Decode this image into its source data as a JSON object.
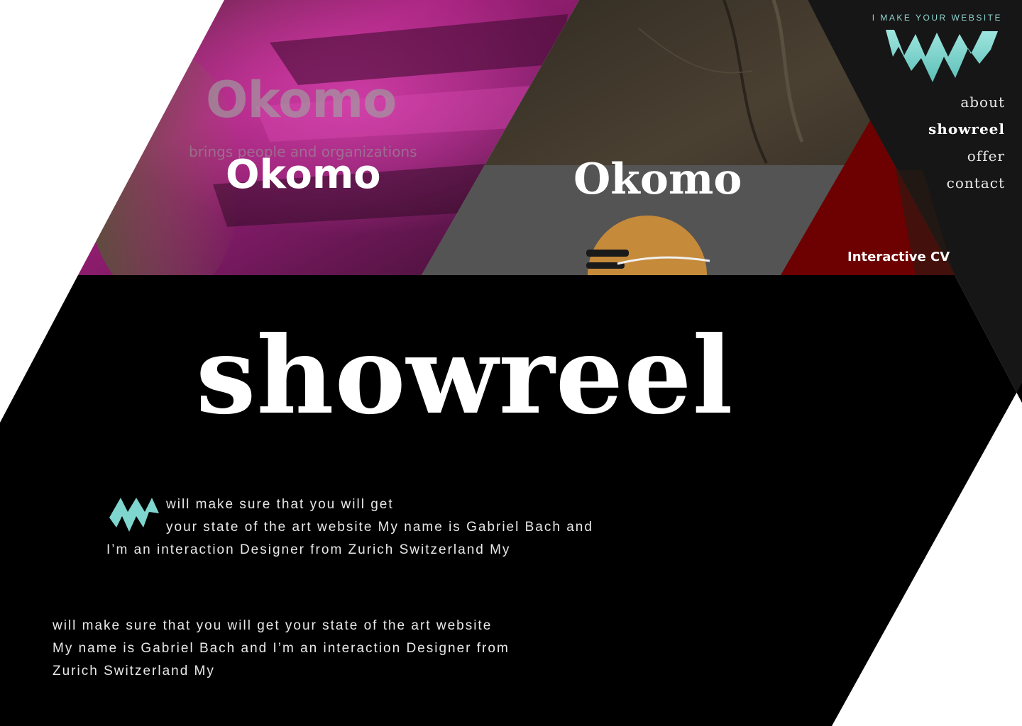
{
  "header": {
    "tagline": "I MAKE YOUR WEBSITE",
    "logo_icon": "zigzag-logo-icon"
  },
  "nav": {
    "items": [
      {
        "label": "about"
      },
      {
        "label": "showreel"
      },
      {
        "label": "offer"
      },
      {
        "label": "contact"
      }
    ],
    "active": "showreel"
  },
  "showreel": {
    "thumbnails": [
      {
        "faint_title": "Okomo",
        "faint_subtitle": "brings people and organizations",
        "title": "Okomo"
      },
      {
        "title": "Okomo"
      },
      {
        "label": "Interactive CV"
      }
    ]
  },
  "main": {
    "heading": "showreel",
    "intro_lines": [
      "will make sure that you will get",
      "your state of the art website My name is Gabriel Bach and",
      "I’m an interaction Designer from Zurich Switzerland My"
    ],
    "body_lines": [
      "will make sure that you will get  your state of the art website",
      "My name is Gabriel Bach and I’m an interaction Designer from",
      "Zurich Switzerland My"
    ]
  },
  "colors": {
    "accent": "#7fd6cf",
    "background": "#000000",
    "nav_panel": "#161616",
    "thumb_magenta": "#8a1f6d",
    "thumb_brown": "#3a3228",
    "thumb_grey": "#545454",
    "thumb_red": "#6d0000",
    "thumb_orange": "#c58a3a"
  }
}
